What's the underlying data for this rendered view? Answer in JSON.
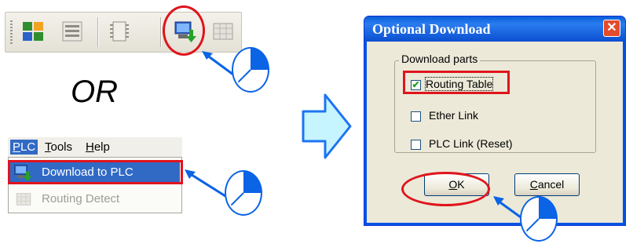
{
  "or_label": "OR",
  "menu": {
    "bar": [
      {
        "label": "PLC",
        "underline": "P",
        "rest": "LC"
      },
      {
        "label": "Tools",
        "underline": "T",
        "rest": "ools"
      },
      {
        "label": "Help",
        "underline": "H",
        "rest": "elp"
      }
    ],
    "items": [
      {
        "label": "Download to PLC",
        "enabled": true
      },
      {
        "label": "Routing Detect",
        "enabled": false
      }
    ]
  },
  "dialog": {
    "title": "Optional Download",
    "close_glyph": "✕",
    "group_label": "Download parts",
    "options": [
      {
        "label": "Routing Table",
        "checked": true
      },
      {
        "label": "Ether Link",
        "checked": false
      },
      {
        "label": "PLC Link (Reset)",
        "checked": false
      }
    ],
    "ok_label": "OK",
    "ok_mnemonic": "O",
    "ok_rest": "K",
    "cancel_label": "Cancel",
    "cancel_mnemonic": "C",
    "cancel_rest": "ancel"
  },
  "icons": {
    "toolbar": [
      "grid-color-icon",
      "list-icon",
      "chip-icon",
      "download-to-plc-icon",
      "routing-grid-icon"
    ],
    "pointer": "pie-pointer-icon",
    "arrow": "right-arrow-icon"
  },
  "colors": {
    "highlight_red": "#e0141c",
    "pointer_blue": "#0b63e6",
    "arrow_cyan": "#c6f4ff",
    "selection_blue": "#316ac5",
    "xp_title_blue": "#0a5fd6"
  }
}
